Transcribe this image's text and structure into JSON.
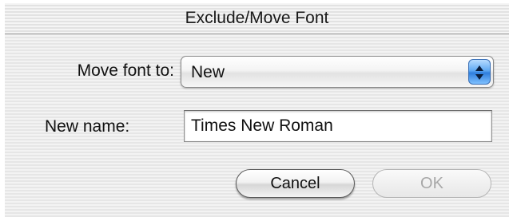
{
  "window": {
    "title": "Exclude/Move Font"
  },
  "form": {
    "move_label": "Move font to:",
    "move_value": "New",
    "name_label": "New name:",
    "name_value": "Times New Roman"
  },
  "buttons": {
    "cancel_label": "Cancel",
    "ok_label": "OK",
    "ok_enabled": false
  },
  "icons": {
    "popup_arrows": "up-down-arrows-icon"
  },
  "colors": {
    "popup_accent": "#2e7ddc"
  }
}
